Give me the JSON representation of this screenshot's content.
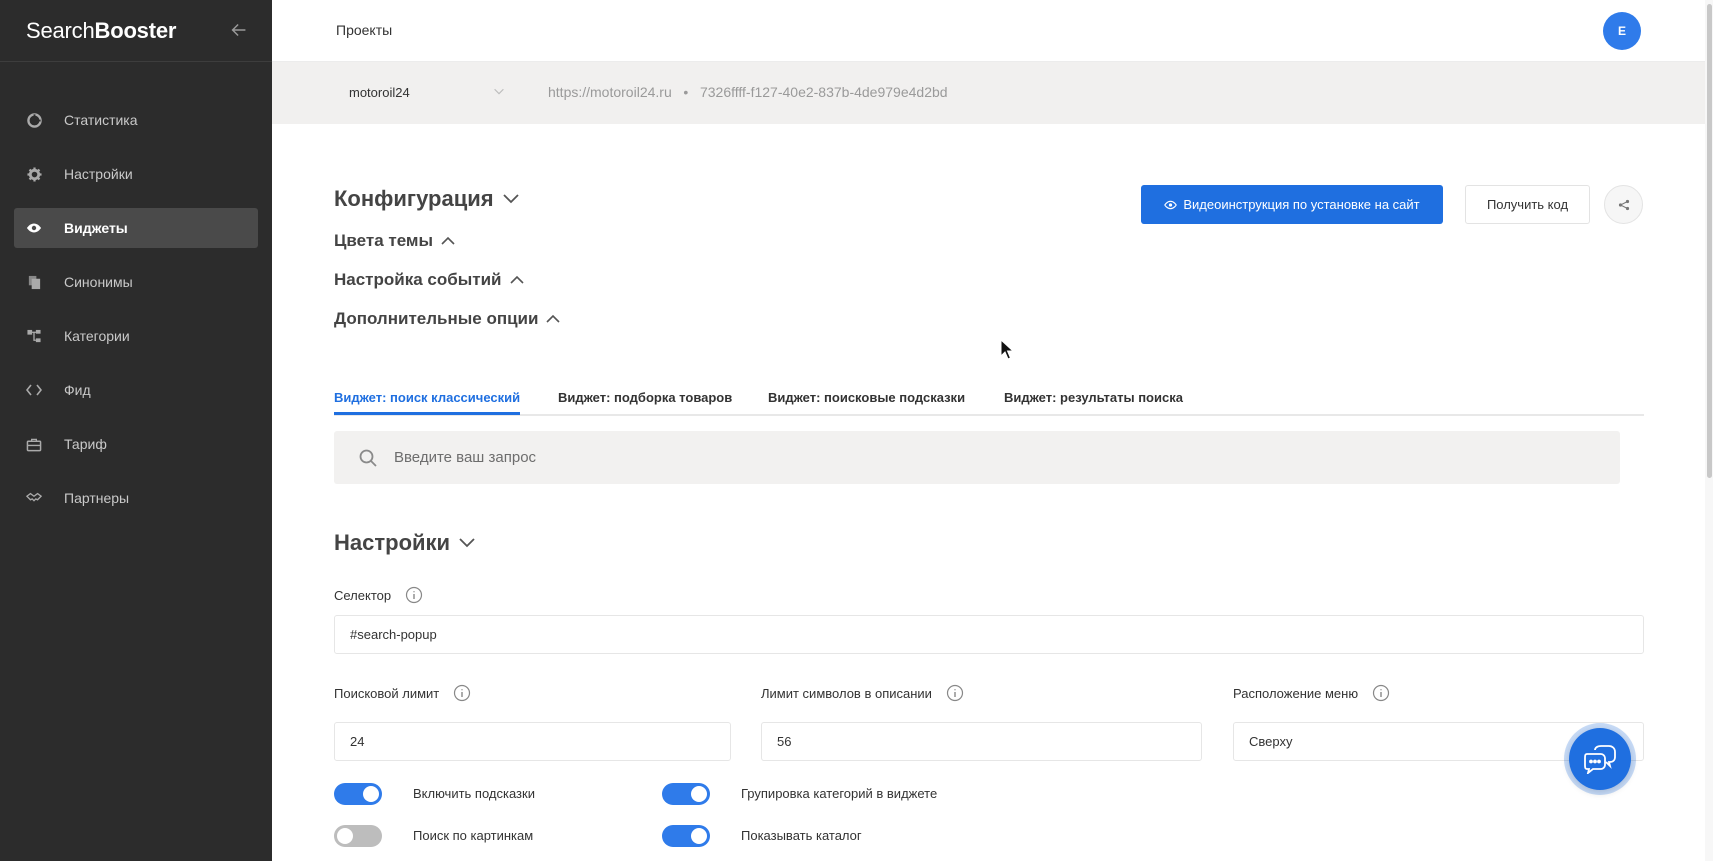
{
  "sidebar": {
    "brand_light": "Search",
    "brand_bold": "Booster",
    "items": [
      {
        "label": "Статистика",
        "icon": "chart-pie-icon"
      },
      {
        "label": "Настройки",
        "icon": "gear-icon"
      },
      {
        "label": "Виджеты",
        "icon": "eye-icon",
        "active": true
      },
      {
        "label": "Синонимы",
        "icon": "copy-icon"
      },
      {
        "label": "Категории",
        "icon": "tree-icon"
      },
      {
        "label": "Фид",
        "icon": "code-icon"
      },
      {
        "label": "Тариф",
        "icon": "briefcase-icon"
      },
      {
        "label": "Партнеры",
        "icon": "handshake-icon"
      }
    ]
  },
  "header": {
    "breadcrumb": "Проекты",
    "avatar_initial": "E"
  },
  "project": {
    "name": "motoroil24",
    "url": "https://motoroil24.ru",
    "separator": "•",
    "id": "7326ffff-f127-40e2-837b-4de979e4d2bd"
  },
  "config": {
    "title": "Конфигурация",
    "theme_colors": "Цвета темы",
    "events": "Настройка событий",
    "extra_options": "Дополнительные опции"
  },
  "actions": {
    "video_button": "Видеоинструкция по установке на сайт",
    "get_code_button": "Получить код"
  },
  "tabs": [
    "Виджет: поиск классический",
    "Виджет: подборка товаров",
    "Виджет: поисковые подсказки",
    "Виджет: результаты поиска"
  ],
  "search": {
    "placeholder": "Введите ваш запрос"
  },
  "settings": {
    "title": "Настройки",
    "selector_label": "Селектор",
    "selector_value": "#search-popup",
    "search_limit_label": "Поисковой лимит",
    "search_limit_value": "24",
    "desc_limit_label": "Лимит символов в описании",
    "desc_limit_value": "56",
    "menu_position_label": "Расположение меню",
    "menu_position_value": "Сверху",
    "toggles": [
      {
        "label": "Включить подсказки",
        "on": true
      },
      {
        "label": "Групировка категорий в виджете",
        "on": true
      },
      {
        "label": "Поиск по картинкам",
        "on": false
      },
      {
        "label": "Показывать каталог",
        "on": true
      }
    ]
  },
  "colors": {
    "accent": "#1f6fe0",
    "sidebar_bg": "#2c2c2c"
  }
}
